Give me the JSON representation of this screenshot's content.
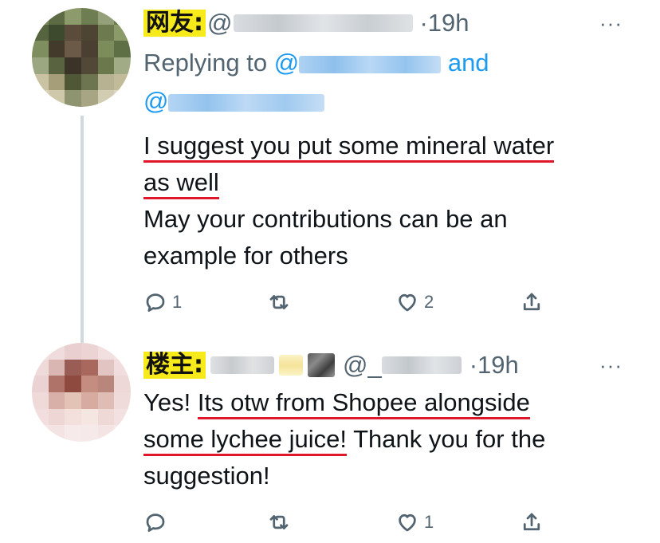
{
  "tweet1": {
    "tag": "网友:",
    "at": "@",
    "time": "·19h",
    "replying_prefix": "Replying to",
    "replying_at1": "@",
    "replying_and": "and",
    "replying_at2": "@",
    "line1": "I suggest you put some mineral water",
    "line2": "as well",
    "line3": "May your contributions can be an",
    "line4": "example for others",
    "reply_count": "1",
    "like_count": "2",
    "more": "···"
  },
  "tweet2": {
    "tag": "楼主:",
    "at": "@_",
    "time": "·19h",
    "text1_prefix": "Yes! ",
    "text1_underlined": "Its otw from Shopee alongside",
    "text2_underlined": "some lychee juice!",
    "text2_rest": " Thank you for the",
    "text3": "suggestion!",
    "like_count": "1",
    "more": "···"
  },
  "icons": {
    "reply": "reply-icon",
    "retweet": "retweet-icon",
    "like": "heart-icon",
    "share": "share-icon"
  },
  "colors": {
    "link": "#1d9bf0",
    "underline": "#e0162b",
    "tag_bg": "#f7ea1b",
    "muted": "#536471"
  }
}
